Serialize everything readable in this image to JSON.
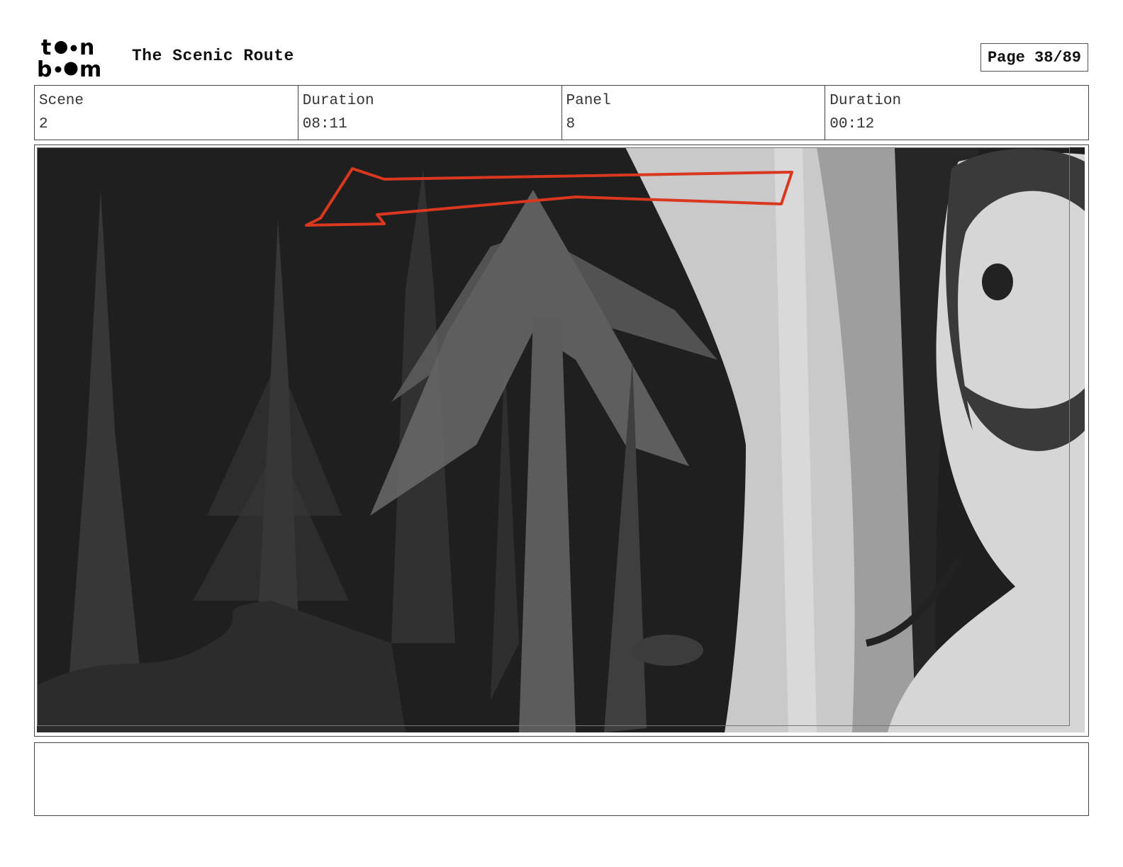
{
  "header": {
    "logo_text": "toon boom",
    "title": "The Scenic Route",
    "page_label": "Page 38/89"
  },
  "info": {
    "scene_label": "Scene",
    "scene_value": "2",
    "scene_duration_label": "Duration",
    "scene_duration_value": "08:11",
    "panel_label": "Panel",
    "panel_value": "8",
    "panel_duration_label": "Duration",
    "panel_duration_value": "00:12"
  },
  "notes": {
    "text": ""
  },
  "colors": {
    "annotation_red": "#d9381e",
    "night_background": "#1f1f1f"
  }
}
